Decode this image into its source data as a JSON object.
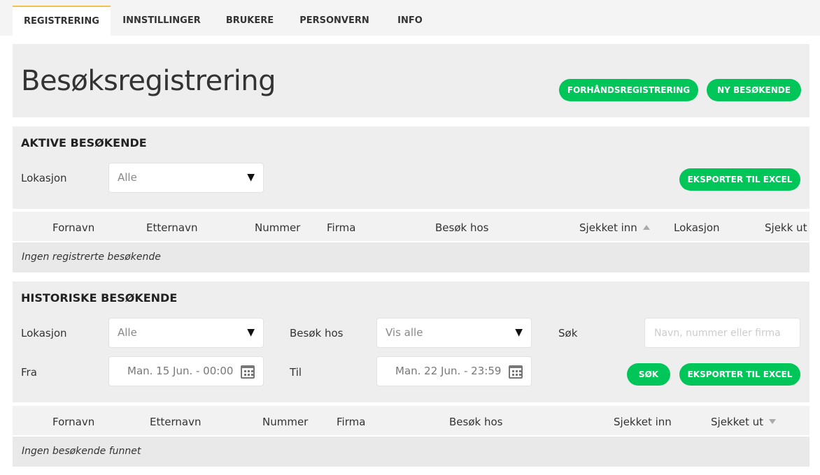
{
  "tabs": [
    {
      "label": "REGISTRERING",
      "active": true
    },
    {
      "label": "INNSTILLINGER",
      "active": false
    },
    {
      "label": "BRUKERE",
      "active": false
    },
    {
      "label": "PERSONVERN",
      "active": false
    },
    {
      "label": "INFO",
      "active": false
    }
  ],
  "header": {
    "title": "Besøksregistrering",
    "preregister_label": "FORHÅNDSREGISTRERING",
    "new_visitor_label": "NY BESØKENDE"
  },
  "active": {
    "title": "AKTIVE BESØKENDE",
    "location_label": "Lokasjon",
    "location_value": "Alle",
    "export_label": "EKSPORTER TIL EXCEL",
    "columns": [
      "Fornavn",
      "Etternavn",
      "Nummer",
      "Firma",
      "Besøk hos",
      "Sjekket inn",
      "Lokasjon",
      "Sjekk ut"
    ],
    "empty_text": "Ingen registrerte besøkende"
  },
  "history": {
    "title": "HISTORISKE BESØKENDE",
    "location_label": "Lokasjon",
    "location_value": "Alle",
    "host_label": "Besøk hos",
    "host_value": "Vis alle",
    "search_label": "Søk",
    "search_placeholder": "Navn, nummer eller firma",
    "from_label": "Fra",
    "from_value": "Man. 15 Jun. - 00:00",
    "to_label": "Til",
    "to_value": "Man. 22 Jun. - 23:59",
    "search_button_label": "SØK",
    "export_label": "EKSPORTER TIL EXCEL",
    "columns": [
      "Fornavn",
      "Etternavn",
      "Nummer",
      "Firma",
      "Besøk hos",
      "Sjekket inn",
      "Sjekket ut"
    ],
    "empty_text": "Ingen besøkende funnet"
  },
  "colors": {
    "accent": "#00c65a",
    "tab_indicator": "#f2c34c",
    "panel": "#eeeeee"
  }
}
